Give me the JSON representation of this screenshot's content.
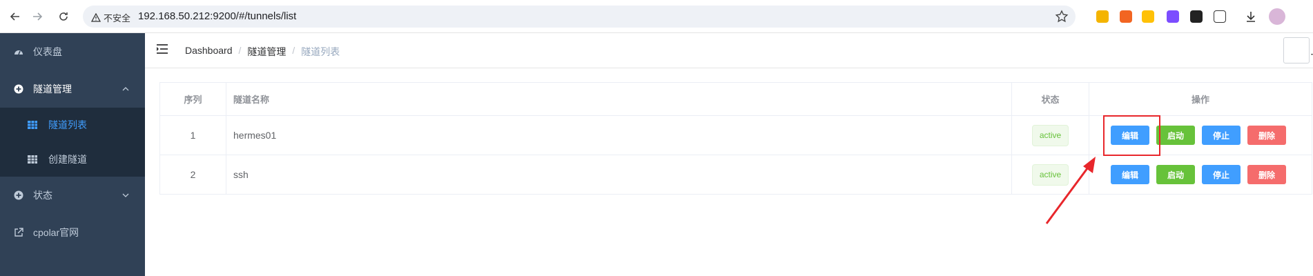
{
  "browser": {
    "insecure_label": "不安全",
    "url": "192.168.50.212:9200/#/tunnels/list"
  },
  "sidebar": {
    "items": [
      {
        "label": "仪表盘",
        "icon": "dashboard-icon"
      },
      {
        "label": "隧道管理",
        "icon": "plus-circle-icon",
        "expanded": true
      },
      {
        "label": "状态",
        "icon": "plus-circle-icon",
        "expanded": false
      },
      {
        "label": "cpolar官网",
        "icon": "external-link-icon"
      }
    ],
    "subitems": [
      {
        "label": "隧道列表",
        "icon": "grid-icon",
        "active": true
      },
      {
        "label": "创建隧道",
        "icon": "grid-icon",
        "active": false
      }
    ]
  },
  "breadcrumb": [
    "Dashboard",
    "隧道管理",
    "隧道列表"
  ],
  "table": {
    "headers": [
      "序列",
      "隧道名称",
      "状态",
      "操作"
    ],
    "rows": [
      {
        "idx": "1",
        "name": "hermes01",
        "status": "active"
      },
      {
        "idx": "2",
        "name": "ssh",
        "status": "active"
      }
    ],
    "actions": {
      "edit": "编辑",
      "start": "启动",
      "stop": "停止",
      "delete": "删除"
    }
  },
  "colors": {
    "sidebar_bg": "#304156",
    "sidebar_active_text": "#409eff",
    "primary": "#409eff",
    "success": "#67c23a",
    "danger": "#f56c6c",
    "annotation": "#e8262b"
  }
}
